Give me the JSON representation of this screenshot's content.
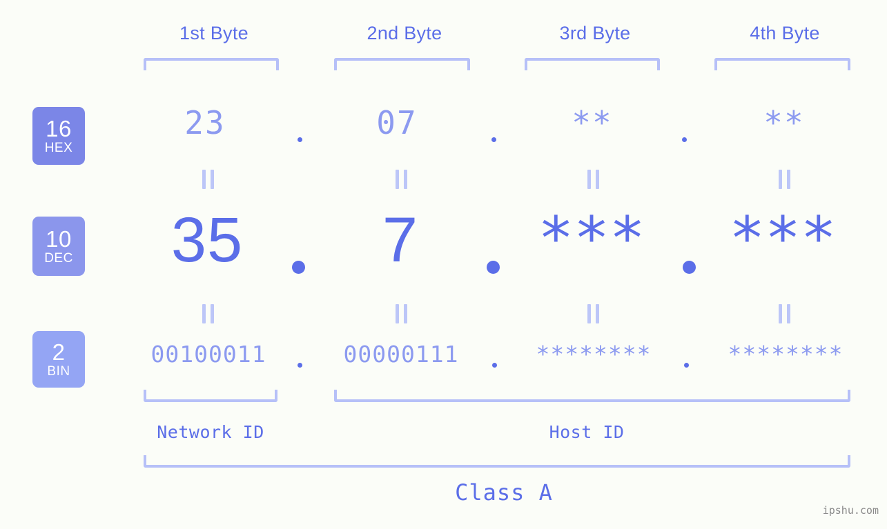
{
  "background_color": "#fbfdf8",
  "accent_color": "#5b6ee8",
  "bracket_color": "#b6c0f8",
  "header": {
    "byte_labels": [
      {
        "label": "1st Byte"
      },
      {
        "label": "2nd Byte"
      },
      {
        "label": "3rd Byte"
      },
      {
        "label": "4th Byte"
      }
    ]
  },
  "bases": [
    {
      "number": "16",
      "name": "HEX",
      "color": "#7b86e7"
    },
    {
      "number": "10",
      "name": "DEC",
      "color": "#8b96ec"
    },
    {
      "number": "2",
      "name": "BIN",
      "color": "#94a5f4"
    }
  ],
  "rows": {
    "hex": {
      "values": [
        "23",
        "07",
        "**",
        "**"
      ]
    },
    "dec": {
      "values": [
        "35",
        "7",
        "***",
        "***"
      ]
    },
    "bin": {
      "values": [
        "00100011",
        "00000111",
        "********",
        "********"
      ]
    }
  },
  "separators": {
    "glyph": "."
  },
  "connectors": {
    "glyph": "="
  },
  "regions": [
    {
      "label": "Network ID"
    },
    {
      "label": "Host ID"
    }
  ],
  "class": {
    "label": "Class A"
  },
  "watermark": {
    "text": "ipshu.com"
  }
}
